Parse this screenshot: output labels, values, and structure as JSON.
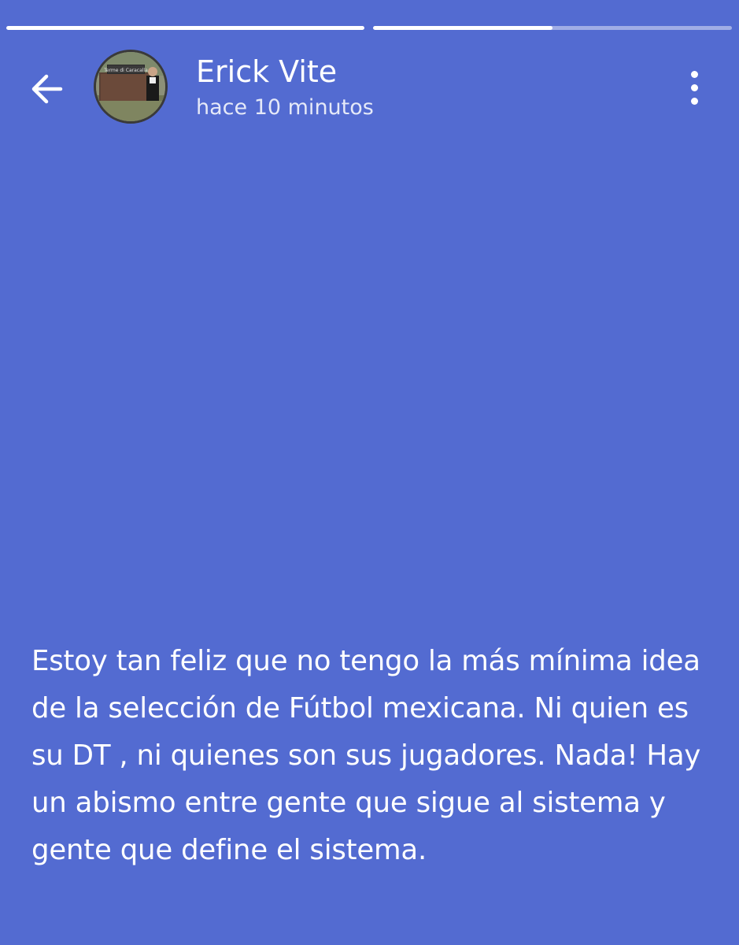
{
  "header": {
    "user_name": "Erick Vite",
    "timestamp": "hace 10 minutos",
    "back_icon": "arrow-left-icon",
    "menu_icon": "more-vertical-icon"
  },
  "progress": {
    "segments": [
      {
        "state": "complete",
        "fill_percent": 100
      },
      {
        "state": "active",
        "fill_percent": 50
      }
    ]
  },
  "story": {
    "text": "Estoy tan feliz que no tengo la más mínima idea de la selección de Fútbol mexicana. Ni quien es su DT , ni quienes son sus jugadores. Nada! Hay un abismo entre gente que sigue al sistema y gente que define el sistema.",
    "background_color": "#536bd1"
  },
  "avatar": {
    "sign_text": "Terme di Caracalla"
  }
}
